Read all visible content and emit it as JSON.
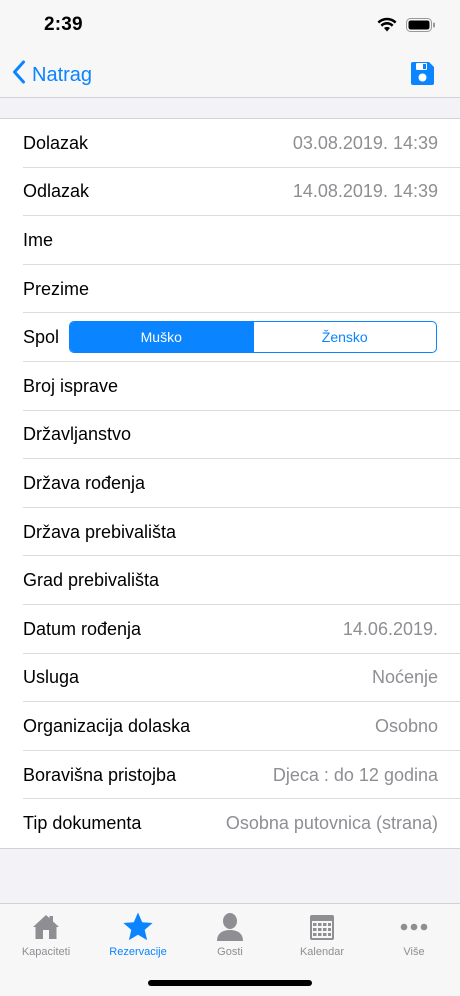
{
  "status_bar": {
    "time": "2:39"
  },
  "nav": {
    "back_label": "Natrag"
  },
  "form": {
    "rows": [
      {
        "label": "Dolazak",
        "value": "03.08.2019. 14:39"
      },
      {
        "label": "Odlazak",
        "value": "14.08.2019. 14:39"
      },
      {
        "label": "Ime",
        "value": ""
      },
      {
        "label": "Prezime",
        "value": ""
      },
      {
        "label": "Spol",
        "options": [
          "Muško",
          "Žensko"
        ],
        "selected": "Muško"
      },
      {
        "label": "Broj isprave",
        "value": ""
      },
      {
        "label": "Državljanstvo",
        "value": ""
      },
      {
        "label": "Država rođenja",
        "value": ""
      },
      {
        "label": "Država prebivališta",
        "value": ""
      },
      {
        "label": "Grad prebivališta",
        "value": ""
      },
      {
        "label": "Datum rođenja",
        "value": "14.06.2019."
      },
      {
        "label": "Usluga",
        "value": "Noćenje"
      },
      {
        "label": "Organizacija dolaska",
        "value": "Osobno"
      },
      {
        "label": "Boravišna pristojba",
        "value": "Djeca : do 12 godina"
      },
      {
        "label": "Tip dokumenta",
        "value": "Osobna putovnica (strana)"
      }
    ]
  },
  "tabs": [
    {
      "label": "Kapaciteti",
      "icon": "house-icon",
      "active": false
    },
    {
      "label": "Rezervacije",
      "icon": "star-icon",
      "active": true
    },
    {
      "label": "Gosti",
      "icon": "person-icon",
      "active": false
    },
    {
      "label": "Kalendar",
      "icon": "calendar-icon",
      "active": false
    },
    {
      "label": "Više",
      "icon": "more-icon",
      "active": false
    }
  ],
  "colors": {
    "accent": "#0a84ff",
    "secondary_text": "#8e8e93",
    "background": "#f2f2f7"
  }
}
